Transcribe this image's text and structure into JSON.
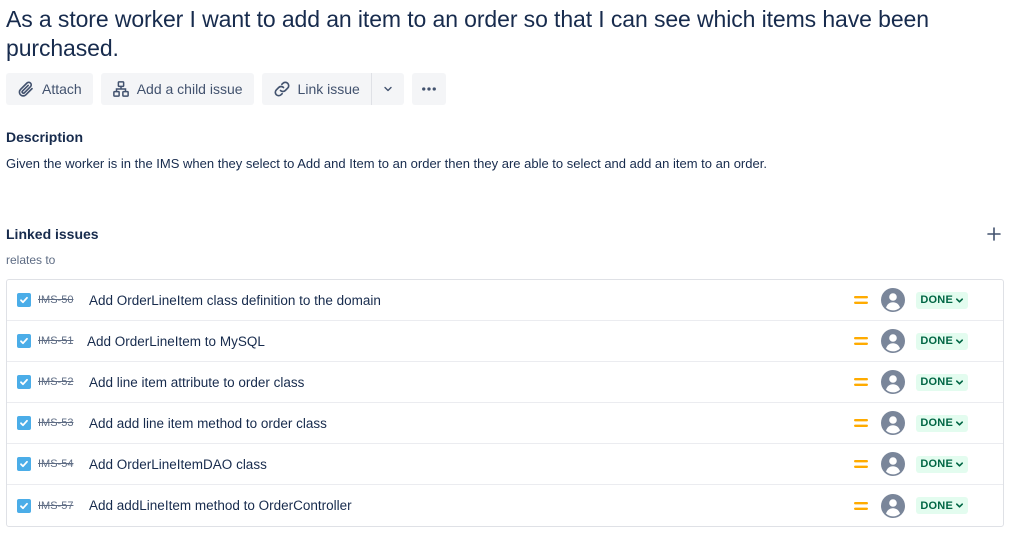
{
  "issue": {
    "title": "As a store worker I want to add an item to an order so that I can see which items have been purchased."
  },
  "toolbar": {
    "attach_label": "Attach",
    "child_issue_label": "Add a child issue",
    "link_issue_label": "Link issue"
  },
  "description": {
    "heading": "Description",
    "text": "Given the worker is in the IMS when they select to Add and Item to an order then they are able to select and add an item to an order."
  },
  "linked": {
    "heading": "Linked issues",
    "relation": "relates to",
    "items": [
      {
        "key": "IMS-50",
        "summary": "Add OrderLineItem class definition to the domain",
        "status": "DONE"
      },
      {
        "key": "IMS-51",
        "summary": "Add OrderLineItem to MySQL",
        "status": "DONE"
      },
      {
        "key": "IMS-52",
        "summary": "Add line item attribute to order class",
        "status": "DONE"
      },
      {
        "key": "IMS-53",
        "summary": "Add add line item method to order class",
        "status": "DONE"
      },
      {
        "key": "IMS-54",
        "summary": "Add OrderLineItemDAO class",
        "status": "DONE"
      },
      {
        "key": "IMS-57",
        "summary": "Add addLineItem method to OrderController",
        "status": "DONE"
      }
    ]
  },
  "colors": {
    "checkbox": "#4bade8",
    "priority_medium": "#ffab00",
    "avatar": "#7a869a",
    "done_bg": "#e3fcef",
    "done_text": "#006644"
  },
  "icons": {
    "attach": "paperclip-icon",
    "child_issue": "hierarchy-icon",
    "link_issue": "link-icon",
    "dropdown": "chevron-down-icon",
    "more": "more-dots-icon",
    "add_link": "plus-icon",
    "priority": "priority-medium-icon",
    "assignee": "unassigned-avatar-icon"
  }
}
